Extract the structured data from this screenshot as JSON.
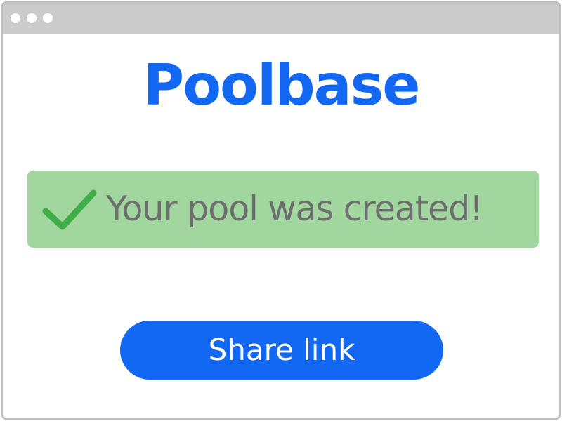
{
  "app": {
    "logo_text": "Poolbase"
  },
  "alert": {
    "icon": "checkmark-icon",
    "message": "Your pool was created!"
  },
  "actions": {
    "share_label": "Share link"
  },
  "colors": {
    "brand": "#1268f3",
    "success_bg": "#a1d69e",
    "check_green": "#3fae49",
    "text_muted": "#6e6e6e",
    "titlebar": "#cbcbcb"
  }
}
